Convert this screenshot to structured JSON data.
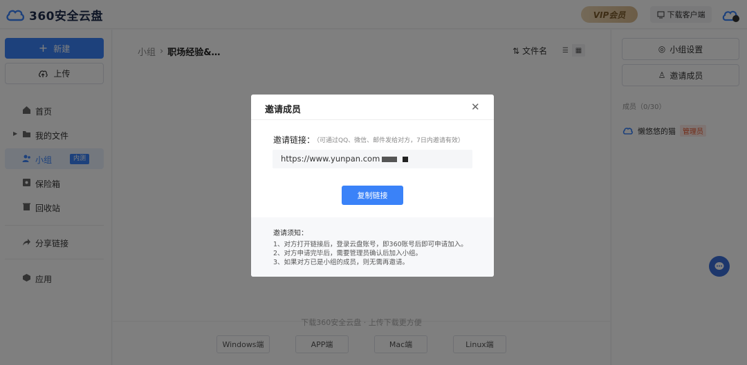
{
  "header": {
    "logo_text": "360安全云盘",
    "vip_label": "VIP会员",
    "download_client_label": "下载客户端"
  },
  "sidebar": {
    "new_label": "新建",
    "upload_label": "上传",
    "items": [
      {
        "label": "首页"
      },
      {
        "label": "我的文件"
      },
      {
        "label": "小组",
        "badge": "内测"
      },
      {
        "label": "保险箱"
      },
      {
        "label": "回收站"
      },
      {
        "label": "分享链接"
      },
      {
        "label": "应用"
      }
    ]
  },
  "main": {
    "breadcrumb": [
      "小组",
      "职场经验&…"
    ],
    "sort_label": "文件名",
    "footer_tip": "下载360安全云盘 · 上传下载更方便",
    "download_buttons": [
      "Windows端",
      "APP端",
      "Mac端",
      "Linux端"
    ]
  },
  "right_panel": {
    "group_settings_label": "小组设置",
    "invite_member_label": "邀请成员",
    "members_label": "成员（0/30）",
    "member": {
      "name": "懒悠悠的猫",
      "role": "管理员"
    }
  },
  "modal": {
    "title": "邀请成员",
    "invite_label": "邀请链接：",
    "invite_hint": "（可通过QQ、微信、邮件发给对方，7日内邀请有效）",
    "link_value": "https://www.yunpan.com",
    "copy_button": "复制链接",
    "notice_title": "邀请须知：",
    "notice_items": [
      "1、对方打开链接后，登录云盘账号，即360账号后即可申请加入。",
      "2、对方申请完毕后，需要管理员确认后加入小组。",
      "3、如果对方已是小组的成员，则无需再邀请。"
    ]
  },
  "colors": {
    "primary": "#3a82f8",
    "overlay": "rgba(0,0,0,0.5)",
    "admin_badge": "#e4572e"
  },
  "icons": {
    "logo": "cloud-logo-icon",
    "close": "close-icon",
    "chat": "chat-bubble-icon"
  }
}
